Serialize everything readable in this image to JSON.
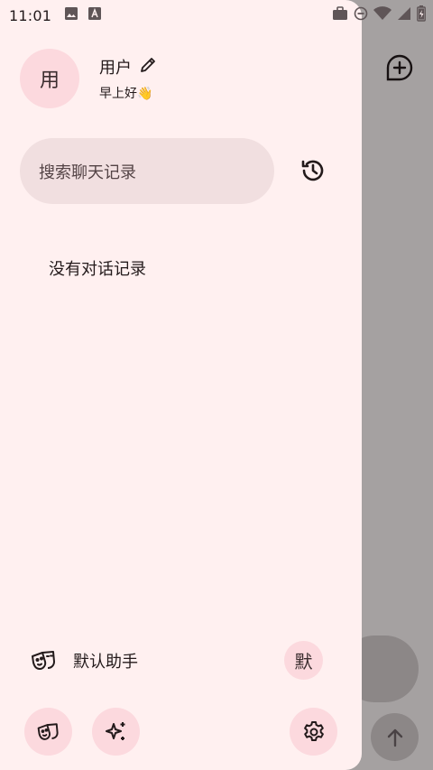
{
  "status_bar": {
    "time": "11:01",
    "left_icons": [
      "image-icon",
      "text-a-icon"
    ],
    "right_icons": [
      "briefcase-icon",
      "do-not-disturb-icon",
      "wifi-icon",
      "signal-icon",
      "battery-icon"
    ]
  },
  "drawer": {
    "avatar_text": "用",
    "user_name": "用户",
    "greeting": "早上好👋",
    "search_placeholder": "搜索聊天记录",
    "empty_text": "没有对话记录",
    "assistant_label": "默认助手",
    "assistant_badge": "默"
  },
  "colors": {
    "drawer_bg": "#fff0f0",
    "accent_pink": "#fcd9de",
    "search_bg": "#f1dfe0"
  }
}
